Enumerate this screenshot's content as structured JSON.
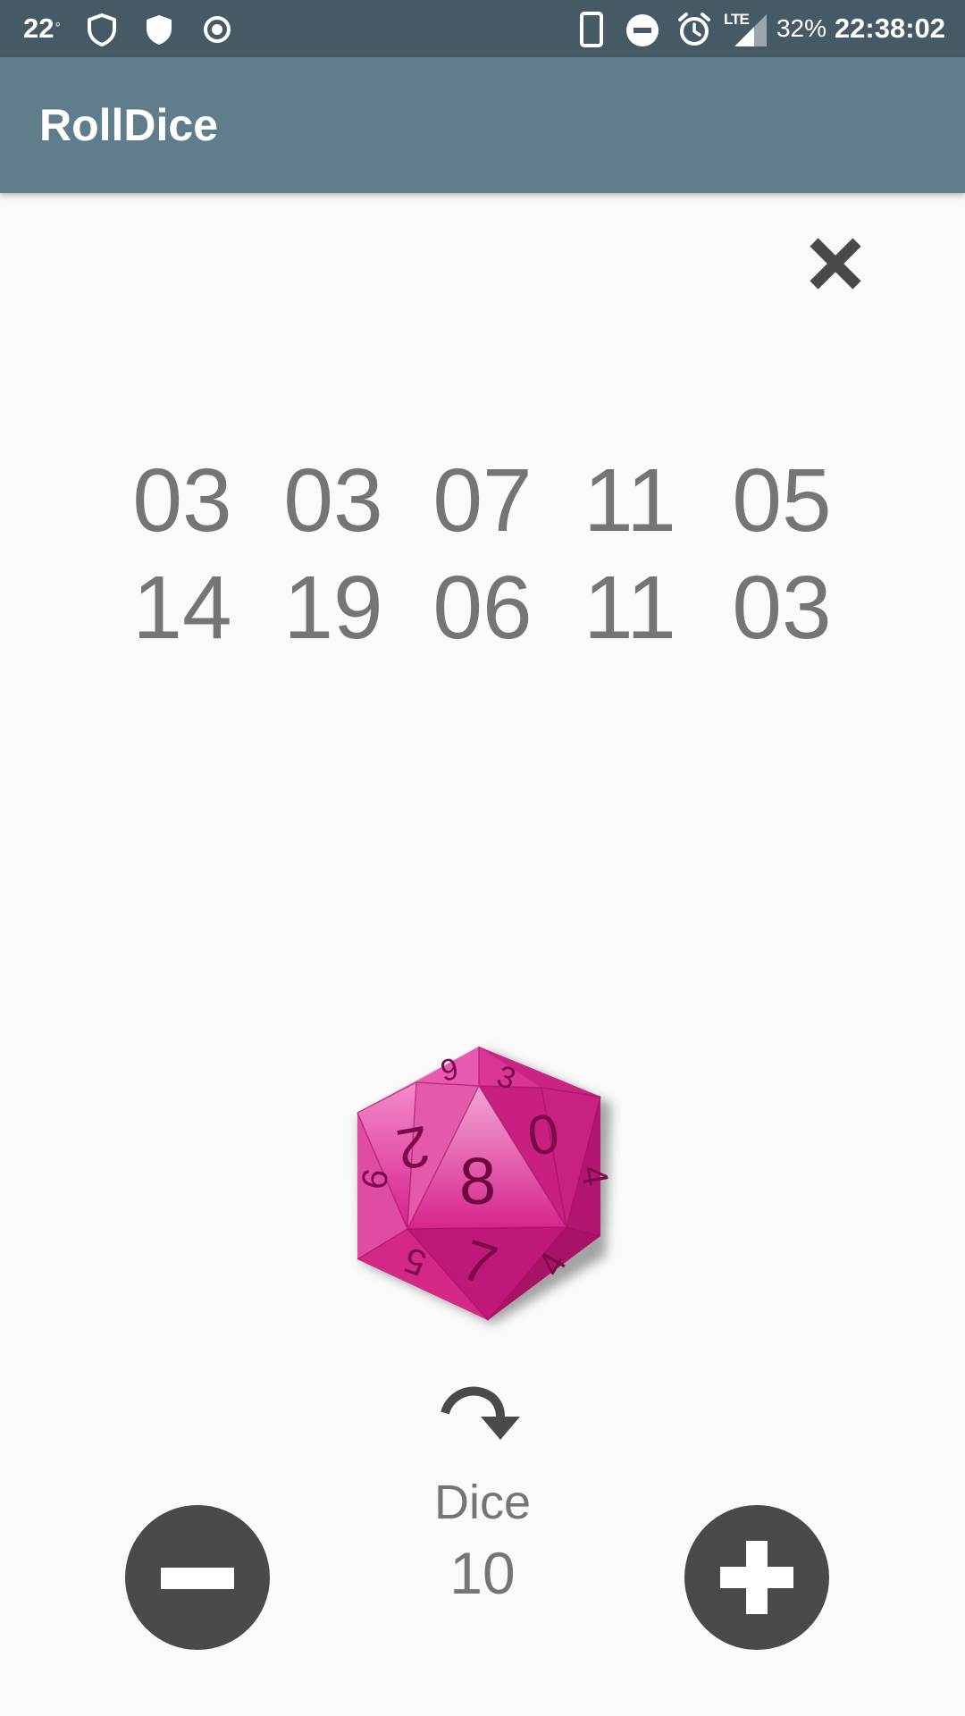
{
  "status_bar": {
    "temperature": "22",
    "degree": "°",
    "battery": "32%",
    "clock": "22:38:02",
    "network": "LTE"
  },
  "app_bar": {
    "title": "RollDice"
  },
  "results": {
    "row1": [
      "03",
      "03",
      "07",
      "11",
      "05"
    ],
    "row2": [
      "14",
      "19",
      "06",
      "11",
      "03"
    ]
  },
  "die": {
    "top_face": "8",
    "face_numbers": [
      "9",
      "3",
      "2",
      "0",
      "6",
      "4",
      "5",
      "7",
      "4"
    ],
    "color": "#d6208a"
  },
  "controls": {
    "dice_label": "Dice",
    "dice_count": "10"
  },
  "colors": {
    "status_bar": "#455a64",
    "app_bar": "#607d8b",
    "background": "#fafafa",
    "text": "#757575",
    "buttons": "#4a4a4a"
  },
  "icons": {
    "close": "close-icon",
    "roll": "redo-arrow-icon",
    "minus": "minus-icon",
    "plus": "plus-icon"
  }
}
